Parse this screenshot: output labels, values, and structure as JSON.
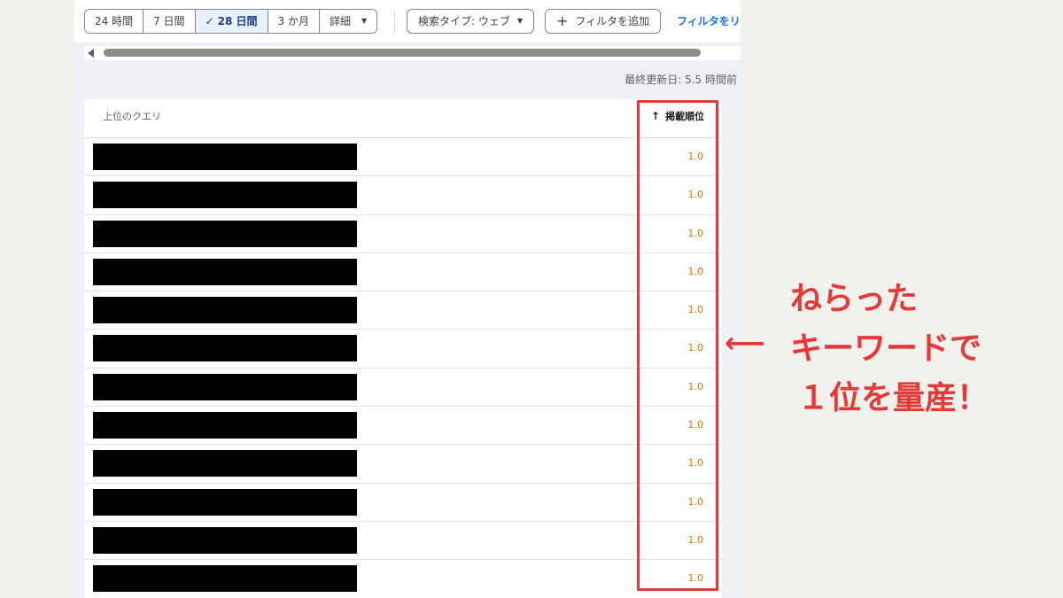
{
  "toolbar": {
    "date_ranges": [
      {
        "label": "24 時間",
        "active": false
      },
      {
        "label": "7 日間",
        "active": false
      },
      {
        "label": "28 日間",
        "active": true
      },
      {
        "label": "3 か月",
        "active": false
      },
      {
        "label": "詳細",
        "active": false
      }
    ],
    "search_type": "検索タイプ: ウェブ",
    "add_filter": "フィルタを追加",
    "reset_filter": "フィルタをリ"
  },
  "last_updated": "最終更新日: 5.5 時間前",
  "table": {
    "col_query": "上位のクエリ",
    "col_position": "掲載順位",
    "rows": [
      "1.0",
      "1.0",
      "1.0",
      "1.0",
      "1.0",
      "1.0",
      "1.0",
      "1.0",
      "1.0",
      "1.0",
      "1.0",
      "1.0"
    ]
  },
  "annotation": {
    "arrow": "⟵",
    "line1": "ねらった",
    "line2": "キーワードで",
    "line3": "１位を量産！"
  },
  "colors": {
    "highlight": "#e53935",
    "position_value": "#e37400",
    "active_segment": "#e8f0fe",
    "link": "#1a73e8"
  }
}
